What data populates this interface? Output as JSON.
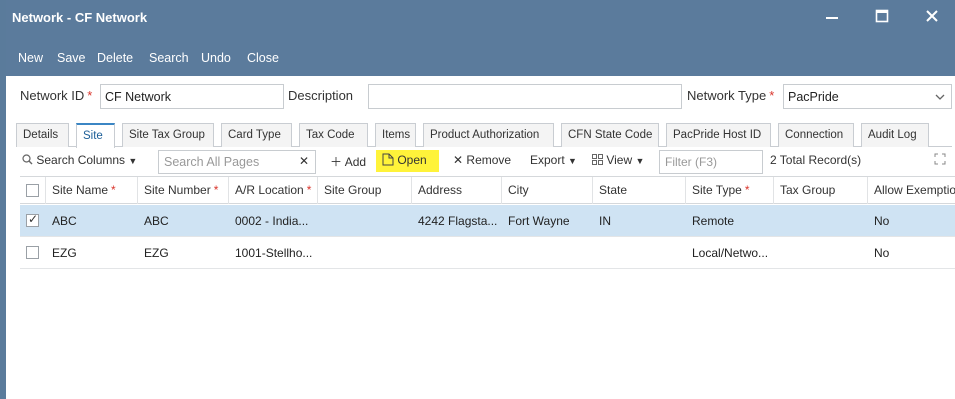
{
  "window": {
    "title": "Network - CF Network",
    "title_bg": "#5b7b9c"
  },
  "toolbar": {
    "new": "New",
    "save": "Save",
    "delete": "Delete",
    "search": "Search",
    "undo": "Undo",
    "close": "Close"
  },
  "form": {
    "network_id_label": "Network ID",
    "network_id_value": "CF Network",
    "description_label": "Description",
    "description_value": "",
    "network_type_label": "Network Type",
    "network_type_value": "PacPride",
    "required_mark": "*"
  },
  "tabs": [
    {
      "label": "Details"
    },
    {
      "label": "Site",
      "active": true
    },
    {
      "label": "Site Tax Group"
    },
    {
      "label": "Card Type"
    },
    {
      "label": "Tax Code"
    },
    {
      "label": "Items"
    },
    {
      "label": "Product Authorization"
    },
    {
      "label": "CFN State Code"
    },
    {
      "label": "PacPride Host ID"
    },
    {
      "label": "Connection"
    },
    {
      "label": "Audit Log"
    }
  ],
  "gridbar": {
    "search_columns": "Search Columns",
    "search_placeholder": "Search All Pages",
    "add": "Add",
    "open": "Open",
    "remove": "Remove",
    "export": "Export",
    "view": "View",
    "filter_placeholder": "Filter (F3)",
    "record_count": "2 Total Record(s)"
  },
  "grid": {
    "columns": [
      "Site Name",
      "Site Number",
      "A/R Location",
      "Site Group",
      "Address",
      "City",
      "State",
      "Site Type",
      "Tax Group",
      "Allow Exemptio"
    ],
    "required_columns": [
      0,
      1,
      2,
      7
    ],
    "rows": [
      {
        "selected": true,
        "cells": [
          "ABC",
          "ABC",
          "0002 - India...",
          "",
          "4242 Flagsta...",
          "Fort Wayne",
          "IN",
          "Remote",
          "",
          "No"
        ]
      },
      {
        "selected": false,
        "cells": [
          "EZG",
          "EZG",
          "1001-Stellho...",
          "",
          "",
          "",
          "",
          "Local/Netwo...",
          "",
          "No"
        ]
      }
    ]
  },
  "colors": {
    "accent": "#3b86c4",
    "selected_row": "#cfe3f3",
    "highlight": "#fff33a",
    "required": "#d9342b"
  }
}
